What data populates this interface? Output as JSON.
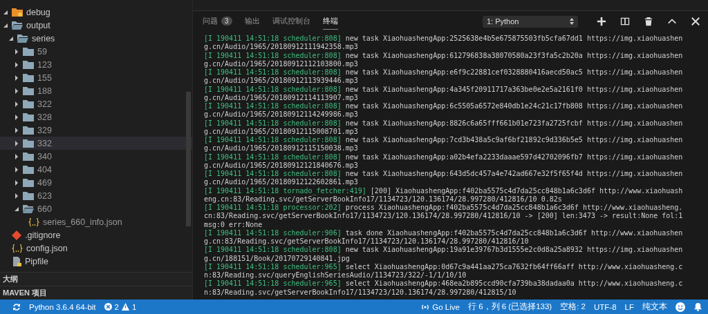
{
  "explorer": {
    "tree": [
      {
        "name": "debug",
        "kind": "debug-folder",
        "expanded": true,
        "selected": false
      },
      {
        "name": "output",
        "kind": "folder",
        "expanded": true,
        "selected": false,
        "children": [
          {
            "name": "series",
            "kind": "folder",
            "expanded": true,
            "selected": false,
            "children": [
              {
                "name": "59",
                "kind": "folder",
                "expanded": false,
                "selected": false
              },
              {
                "name": "123",
                "kind": "folder",
                "expanded": false,
                "selected": false
              },
              {
                "name": "155",
                "kind": "folder",
                "expanded": false,
                "selected": false
              },
              {
                "name": "188",
                "kind": "folder",
                "expanded": false,
                "selected": false
              },
              {
                "name": "322",
                "kind": "folder",
                "expanded": false,
                "selected": false
              },
              {
                "name": "328",
                "kind": "folder",
                "expanded": false,
                "selected": false
              },
              {
                "name": "329",
                "kind": "folder",
                "expanded": false,
                "selected": false
              },
              {
                "name": "332",
                "kind": "folder",
                "expanded": false,
                "selected": true
              },
              {
                "name": "340",
                "kind": "folder",
                "expanded": false,
                "selected": false
              },
              {
                "name": "404",
                "kind": "folder",
                "expanded": false,
                "selected": false
              },
              {
                "name": "469",
                "kind": "folder",
                "expanded": false,
                "selected": false
              },
              {
                "name": "623",
                "kind": "folder",
                "expanded": false,
                "selected": false
              },
              {
                "name": "660",
                "kind": "folder",
                "expanded": true,
                "selected": false,
                "children": [
                  {
                    "name": "series_660_info.json",
                    "kind": "json",
                    "selected": false
                  }
                ]
              }
            ]
          }
        ]
      },
      {
        "name": ".gitignore",
        "kind": "git",
        "selected": false
      },
      {
        "name": "config.json",
        "kind": "json",
        "selected": false
      },
      {
        "name": "Pipfile",
        "kind": "pipfile",
        "selected": false
      }
    ],
    "sections": [
      "大纲",
      "MAVEN 项目"
    ]
  },
  "panel": {
    "tabs": [
      {
        "label": "问题",
        "badge": "3",
        "selected": false
      },
      {
        "label": "输出",
        "selected": false
      },
      {
        "label": "调试控制台",
        "selected": false
      },
      {
        "label": "终端",
        "selected": true
      }
    ],
    "terminal_select": "1: Python",
    "log": [
      {
        "prefix": "[I 190411 14:51:18 scheduler:808]",
        "message": "new task XiaohuashengApp:2525638e4b5e675875503fb5cfa67dd1 https://img.xiaohuasheng.cn/Audio/1965/20180912111942358.mp3"
      },
      {
        "prefix": "[I 190411 14:51:18 scheduler:808]",
        "message": "new task XiaohuashengApp:612796838a38070580a23f3fa5c2b20a https://img.xiaohuasheng.cn/Audio/1965/20180912112103800.mp3"
      },
      {
        "prefix": "[I 190411 14:51:18 scheduler:808]",
        "message": "new task XiaohuashengApp:e6f9c22881cef0328880416aecd50ac5 https://img.xiaohuasheng.cn/Audio/1965/20180912113939446.mp3"
      },
      {
        "prefix": "[I 190411 14:51:18 scheduler:808]",
        "message": "new task XiaohuashengApp:4a345f20911717a363be0e2e5a2161f0 https://img.xiaohuasheng.cn/Audio/1965/20180912114113907.mp3"
      },
      {
        "prefix": "[I 190411 14:51:18 scheduler:808]",
        "message": "new task XiaohuashengApp:6c5505a6572e840db1e24c21c17fb808 https://img.xiaohuasheng.cn/Audio/1965/20180912114249986.mp3"
      },
      {
        "prefix": "[I 190411 14:51:18 scheduler:808]",
        "message": "new task XiaohuashengApp:8826c6a65fff661b01e723fa2725fcbf https://img.xiaohuasheng.cn/Audio/1965/20180912115008701.mp3"
      },
      {
        "prefix": "[I 190411 14:51:18 scheduler:808]",
        "message": "new task XiaohuashengApp:7cd3b438a5c9af6bf21892c9d336b5e5 https://img.xiaohuasheng.cn/Audio/1965/20180912115150038.mp3"
      },
      {
        "prefix": "[I 190411 14:51:18 scheduler:808]",
        "message": "new task XiaohuashengApp:a02b4efa2233daaae597d42702096fb7 https://img.xiaohuasheng.cn/Audio/1965/20180912121840676.mp3"
      },
      {
        "prefix": "[I 190411 14:51:18 scheduler:808]",
        "message": "new task XiaohuashengApp:643d5dc457a4e742ad667e32f5f65f4d https://img.xiaohuasheng.cn/Audio/1965/20180912122602861.mp3"
      },
      {
        "prefix": "[I 190411 14:51:18 tornado_fetcher:419]",
        "message": "[200] XiaohuashengApp:f402ba5575c4d7da25cc848b1a6c3d6f http://www.xiaohuasheng.cn:83/Reading.svc/getServerBookInfo17/1134723/120.136174/28.997280/412816/10 0.82s"
      },
      {
        "prefix": "[I 190411 14:51:18 processor:202]",
        "message": "process XiaohuashengApp:f402ba5575c4d7da25cc848b1a6c3d6f http://www.xiaohuasheng.cn:83/Reading.svc/getServerBookInfo17/1134723/120.136174/28.997280/412816/10 -> [200] len:3473 -> result:None fol:1 msg:0 err:None"
      },
      {
        "prefix": "[I 190411 14:51:18 scheduler:906]",
        "message": "task done XiaohuashengApp:f402ba5575c4d7da25cc848b1a6c3d6f http://www.xiaohuasheng.cn:83/Reading.svc/getServerBookInfo17/1134723/120.136174/28.997280/412816/10"
      },
      {
        "prefix": "[I 190411 14:51:18 scheduler:808]",
        "message": "new task XiaohuashengApp:19a91e39767b3d1555e2c0d8a25a8932 https://img.xiaohuasheng.cn/188151/Book/20170729140841.jpg"
      },
      {
        "prefix": "[I 190411 14:51:18 scheduler:965]",
        "message": "select XiaohuashengApp:0d67c9a441aa275ca7632fb64ff66aff http://www.xiaohuasheng.cn:83/Reading.svc/queryEnglishSeriesAudio/1134723/322/-1/1/10/10"
      },
      {
        "prefix": "[I 190411 14:51:18 scheduler:965]",
        "message": "select XiaohuashengApp:468ea2b895ccd90cfa739ba38dadaa0a http://www.xiaohuasheng.cn:83/Reading.svc/getServerBookInfo17/1134723/120.136174/28.997280/412815/10"
      }
    ]
  },
  "status_bar": {
    "interpreter": "Python 3.6.4 64-bit",
    "errors": "2",
    "warnings": "1",
    "go_live": "Go Live",
    "cursor": "行 6，列 6 (已选择133)",
    "indent": "空格: 2",
    "encoding": "UTF-8",
    "eol": "LF",
    "language": "纯文本"
  }
}
